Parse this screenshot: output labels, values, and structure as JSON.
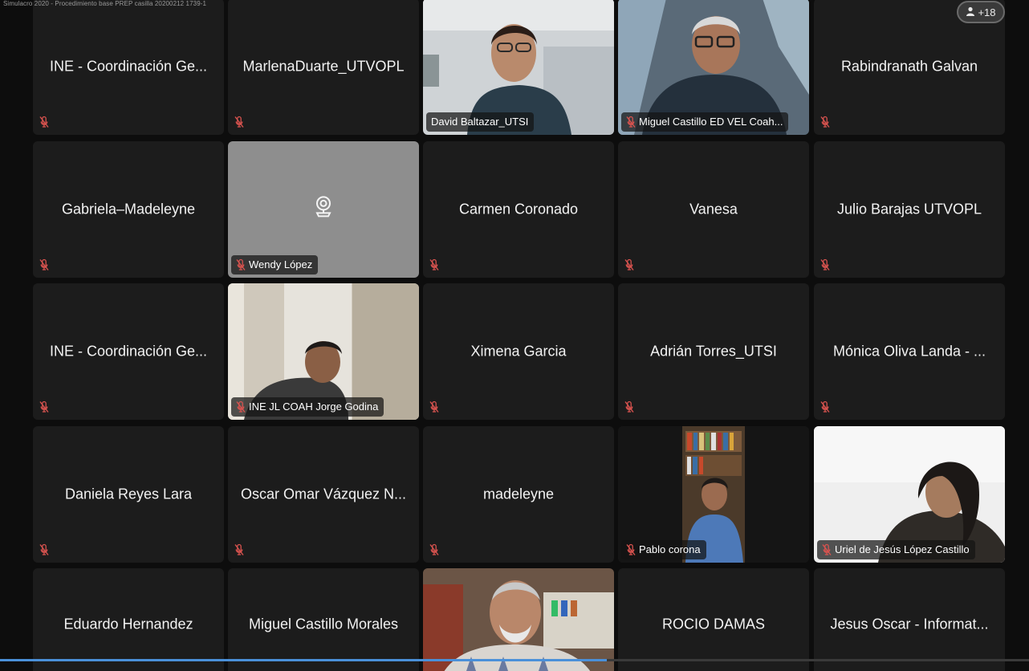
{
  "window": {
    "title": "Simulacro 2020 - Procedimiento base PREP casilla 20200212 1739-1"
  },
  "overflow": {
    "label": "+18"
  },
  "playback": {
    "progress": 0.59
  },
  "colors": {
    "tile": "#1c1c1c",
    "mic_muted": "#d9534f",
    "progress": "#4a90d9"
  },
  "participants": [
    {
      "name": "INE - Coordinación Ge...",
      "video": false,
      "muted": true
    },
    {
      "name": "MarlenaDuarte_UTVOPL",
      "video": false,
      "muted": true
    },
    {
      "name": "David Baltazar_UTSI",
      "video": true,
      "muted": false
    },
    {
      "name": "Miguel Castillo ED VEL Coah...",
      "video": true,
      "muted": true
    },
    {
      "name": "Rabindranath Galvan",
      "video": false,
      "muted": true
    },
    {
      "name": "Gabriela–Madeleyne",
      "video": false,
      "muted": true
    },
    {
      "name": "Wendy López",
      "video": false,
      "camera_off_gray": true,
      "muted": true
    },
    {
      "name": "Carmen Coronado",
      "video": false,
      "muted": true
    },
    {
      "name": "Vanesa",
      "video": false,
      "muted": true
    },
    {
      "name": "Julio Barajas UTVOPL",
      "video": false,
      "muted": true
    },
    {
      "name": "INE - Coordinación Ge...",
      "video": false,
      "muted": true
    },
    {
      "name": "INE JL COAH Jorge Godina",
      "video": true,
      "muted": true
    },
    {
      "name": "Ximena Garcia",
      "video": false,
      "muted": true
    },
    {
      "name": "Adrián Torres_UTSI",
      "video": false,
      "muted": true
    },
    {
      "name": "Mónica Oliva Landa - ...",
      "video": false,
      "muted": true
    },
    {
      "name": "Daniela Reyes Lara",
      "video": false,
      "muted": true
    },
    {
      "name": "Oscar Omar Vázquez N...",
      "video": false,
      "muted": true
    },
    {
      "name": "madeleyne",
      "video": false,
      "muted": true
    },
    {
      "name": "Pablo corona",
      "video": true,
      "muted": true
    },
    {
      "name": "Uriel de Jesús López Castillo",
      "video": true,
      "muted": true
    },
    {
      "name": "Eduardo Hernandez",
      "video": false,
      "muted": false
    },
    {
      "name": "Miguel Castillo Morales",
      "video": false,
      "muted": false
    },
    {
      "name": "",
      "video": true,
      "muted": false
    },
    {
      "name": "ROCIO DAMAS",
      "video": false,
      "muted": false
    },
    {
      "name": "Jesus Oscar - Informat...",
      "video": false,
      "muted": false
    }
  ]
}
